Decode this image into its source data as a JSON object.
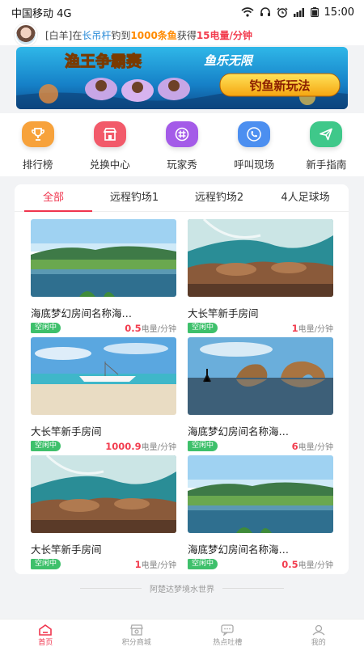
{
  "status": {
    "carrier": "中国移动 4G",
    "time": "15:00"
  },
  "ticker": {
    "p1": "[白羊]在",
    "rod": "长吊杆",
    "p2": "钓到",
    "fish": "1000条鱼",
    "p3": "获得",
    "reward": "15电量/分钟"
  },
  "banner": {
    "title": "渔王争霸赛",
    "slogan": "鱼乐无限",
    "button": "钓鱼新玩法"
  },
  "nav": [
    {
      "label": "排行榜",
      "icon": "trophy-icon",
      "color": "#f7a23b"
    },
    {
      "label": "兑换中心",
      "icon": "shop-icon",
      "color": "#f25a6a"
    },
    {
      "label": "玩家秀",
      "icon": "hashtag-icon",
      "color": "#a45be8"
    },
    {
      "label": "呼叫现场",
      "icon": "phone-icon",
      "color": "#4c8ff0"
    },
    {
      "label": "新手指南",
      "icon": "send-icon",
      "color": "#3fc88a"
    }
  ],
  "tabs": [
    "全部",
    "远程钓场1",
    "远程钓场2",
    "4人足球场"
  ],
  "rooms": [
    {
      "name": "海底梦幻房间名称海…",
      "status": "空闲中",
      "price": "0.5",
      "unit": "电量/分钟",
      "scene": "lake"
    },
    {
      "name": "大长竿新手房间",
      "status": "空闲中",
      "price": "1",
      "unit": "电量/分钟",
      "scene": "rocks"
    },
    {
      "name": "大长竿新手房间",
      "status": "空闲中",
      "price": "1000.9",
      "unit": "电量/分钟",
      "scene": "boat"
    },
    {
      "name": "海底梦幻房间名称海…",
      "status": "空闲中",
      "price": "6",
      "unit": "电量/分钟",
      "scene": "beach"
    },
    {
      "name": "大长竿新手房间",
      "status": "空闲中",
      "price": "1",
      "unit": "电量/分钟",
      "scene": "rocks"
    },
    {
      "name": "海底梦幻房间名称海…",
      "status": "空闲中",
      "price": "0.5",
      "unit": "电量/分钟",
      "scene": "lake"
    }
  ],
  "footer": "阿楚达梦境水世界",
  "tabbar": [
    {
      "label": "首页",
      "icon": "home-icon",
      "active": true
    },
    {
      "label": "积分商城",
      "icon": "store-icon",
      "active": false
    },
    {
      "label": "热点吐槽",
      "icon": "chat-icon",
      "active": false
    },
    {
      "label": "我的",
      "icon": "user-icon",
      "active": false
    }
  ],
  "colors": {
    "accent": "#f0354e",
    "badge": "#3ec06b",
    "link": "#2a8bd8",
    "highlight": "#ff8a00"
  }
}
